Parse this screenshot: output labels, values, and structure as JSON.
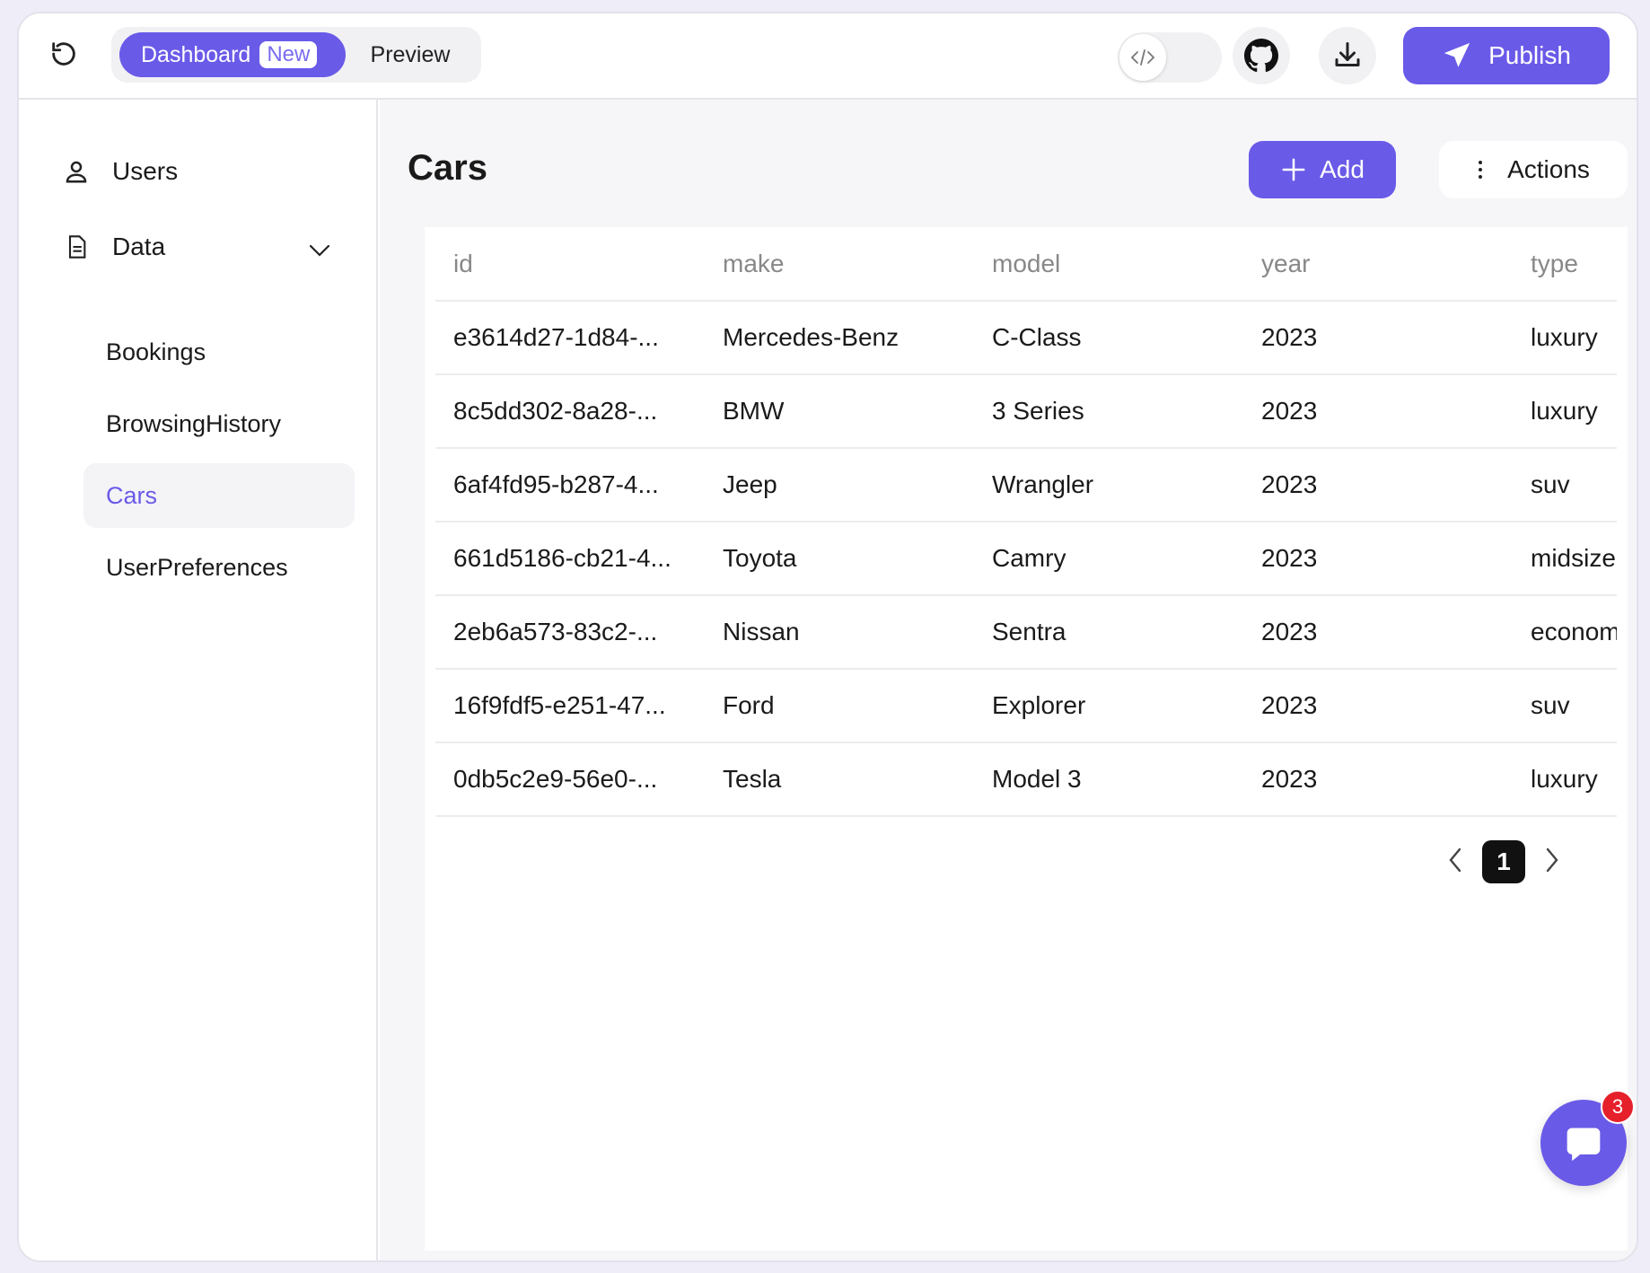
{
  "header": {
    "dashboard_label": "Dashboard",
    "new_badge": "New",
    "preview_label": "Preview",
    "publish_label": "Publish"
  },
  "sidebar": {
    "users_label": "Users",
    "data_label": "Data",
    "items": [
      {
        "label": "Bookings"
      },
      {
        "label": "BrowsingHistory"
      },
      {
        "label": "Cars"
      },
      {
        "label": "UserPreferences"
      }
    ],
    "active_item": "Cars"
  },
  "main": {
    "title": "Cars",
    "add_label": "Add",
    "actions_label": "Actions"
  },
  "table": {
    "columns": [
      "id",
      "make",
      "model",
      "year",
      "type"
    ],
    "rows": [
      [
        "e3614d27-1d84-...",
        "Mercedes-Benz",
        "C-Class",
        "2023",
        "luxury"
      ],
      [
        "8c5dd302-8a28-...",
        "BMW",
        "3 Series",
        "2023",
        "luxury"
      ],
      [
        "6af4fd95-b287-4...",
        "Jeep",
        "Wrangler",
        "2023",
        "suv"
      ],
      [
        "661d5186-cb21-4...",
        "Toyota",
        "Camry",
        "2023",
        "midsize"
      ],
      [
        "2eb6a573-83c2-...",
        "Nissan",
        "Sentra",
        "2023",
        "econom"
      ],
      [
        "16f9fdf5-e251-47...",
        "Ford",
        "Explorer",
        "2023",
        "suv"
      ],
      [
        "0db5c2e9-56e0-...",
        "Tesla",
        "Model 3",
        "2023",
        "luxury"
      ]
    ]
  },
  "pagination": {
    "current_page": "1"
  },
  "chat": {
    "badge_count": "3"
  },
  "colors": {
    "accent": "#6a5ae8",
    "badge": "#e5202a"
  }
}
